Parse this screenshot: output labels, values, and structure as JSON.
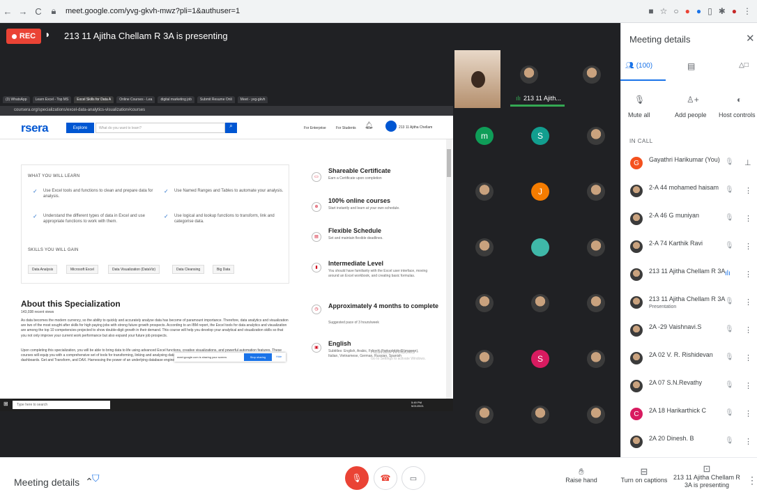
{
  "browser": {
    "url": "meet.google.com/yvg-gkvh-mwz?pli=1&authuser=1"
  },
  "meet": {
    "rec_label": "REC",
    "presenting_text": "213 11 Ajitha Chellam R 3A is presenting",
    "presenter_tile_name": "213 11 Ajith..."
  },
  "shared_screen": {
    "tabs": [
      "(3) WhatsApp",
      "Learn Excel - Top MS",
      "Excel Skills for Data A",
      "Online Courses - Lea",
      "digital marketing job",
      "Submit Resume Onli",
      "Meet - yvg-gkvh"
    ],
    "address": "coursera.org/specializations/excel-data-analytics-visualization#courses",
    "logo": "rsera",
    "explore": "Explore",
    "search_placeholder": "What do you want to learn?",
    "for_enterprise": "For Enterprise",
    "for_students": "For Students",
    "user_name": "213 11 Ajitha Chellam",
    "learn_heading": "WHAT YOU WILL LEARN",
    "learn_items": [
      "Use Excel tools and functions to clean and prepare data for analysis.",
      "Use Named Ranges and Tables to automate your analysis.",
      "Understand the different types of data in Excel and use appropriate functions to work with them.",
      "Use logical and lookup functions to transform, link and categorise data."
    ],
    "skills_heading": "SKILLS YOU WILL GAIN",
    "skills": [
      "Data Analysis",
      "Microsoft Excel",
      "Data Visualization (DataViz)",
      "Data Cleansing",
      "Big Data"
    ],
    "about_heading": "About this Specialization",
    "about_views": "143,038 recent views",
    "about_p1": "As data becomes the modern currency, so the ability to quickly and accurately analyse data has become of paramount importance. Therefore, data analytics and visualization are two of the most sought after skills for high paying jobs with strong future growth prospects. According to an IBM report, the Excel tools for data analytics and visualization are among the top 10 competencies projected to show double-digit growth in their demand. This course will help you develop your analytical and visualization skills so that you not only improve your current work performance but also expand your future job prospects.",
    "about_p2": "Upon completing this specialization, you will be able to bring data to life using advanced Excel functions, creative visualizations, and powerful automation features. These courses will equip you with a comprehensive set of tools for transforming, linking and analysing data. You will master a broad range of charts and create stunning interactive dashboards. Get and Transform, and DAX. Harnessing the power of an underlying database engine we will remove the 1 million row limitation, completely",
    "features": [
      {
        "icon": "▭",
        "title": "Shareable Certificate",
        "sub": "Earn a Certificate upon completion"
      },
      {
        "icon": "⊕",
        "title": "100% online courses",
        "sub": "Start instantly and learn at your own schedule."
      },
      {
        "icon": "▤",
        "title": "Flexible Schedule",
        "sub": "Set and maintain flexible deadlines."
      },
      {
        "icon": "▮",
        "title": "Intermediate Level",
        "sub": "You should have familiarity with the Excel user interface, moving around an Excel workbook, and creating basic formulas."
      },
      {
        "icon": "◷",
        "title": "Approximately 4 months to complete",
        "sub": "Suggested pace of 3 hours/week"
      },
      {
        "icon": "▣",
        "title": "English",
        "sub": "Subtitles: English, Arabic, French, Portuguese (European), Italian, Vietnamese, German, Russian, Spanish"
      }
    ],
    "activate_title": "Activate Windows",
    "activate_sub": "Go to Settings to activate Windows.",
    "sharing_text": "meet.google.com is sharing your screen.",
    "stop_sharing": "Stop sharing",
    "hide": "Hide",
    "taskbar_search": "Type here to search",
    "clock_time": "5:49 PM",
    "clock_date": "5/21/2021"
  },
  "grid_tiles": [
    {
      "kind": "letter",
      "letter": "m",
      "color": "#0f9d58"
    },
    {
      "kind": "letter",
      "letter": "S",
      "color": "#129e8f"
    },
    {
      "kind": "photo"
    },
    {
      "kind": "photo"
    },
    {
      "kind": "letter",
      "letter": "J",
      "color": "#f57c00"
    },
    {
      "kind": "photo"
    },
    {
      "kind": "photo"
    },
    {
      "kind": "letter",
      "letter": "",
      "color": "#3fb8a8"
    },
    {
      "kind": "photo"
    },
    {
      "kind": "photo"
    },
    {
      "kind": "photo"
    },
    {
      "kind": "photo"
    },
    {
      "kind": "photo"
    },
    {
      "kind": "letter",
      "letter": "S",
      "color": "#d81b60"
    },
    {
      "kind": "photo"
    },
    {
      "kind": "photo"
    },
    {
      "kind": "photo"
    },
    {
      "kind": "photo"
    }
  ],
  "sidebar": {
    "title": "Meeting details",
    "people_count": "(100)",
    "mute_all": "Mute all",
    "add_people": "Add people",
    "host_controls": "Host controls",
    "in_call": "IN CALL",
    "participants": [
      {
        "name": "Gayathri Harikumar (You)",
        "sub": "",
        "avatar": "letter",
        "letter": "G",
        "color": "#f4511e",
        "mic": "off",
        "pin": true
      },
      {
        "name": "2-A 44 mohamed haisam",
        "sub": "",
        "avatar": "photo",
        "mic": "off"
      },
      {
        "name": "2-A 46 G muniyan",
        "sub": "",
        "avatar": "photo",
        "mic": "off"
      },
      {
        "name": "2-A 74 Karthik Ravi",
        "sub": "",
        "avatar": "photo",
        "mic": "off"
      },
      {
        "name": "213 11 Ajitha Chellam R 3A",
        "sub": "",
        "avatar": "photo",
        "mic": "on"
      },
      {
        "name": "213 11 Ajitha Chellam R 3A",
        "sub": "Presentation",
        "avatar": "photo",
        "mic": "off"
      },
      {
        "name": "2A -29 Vaishnavi.S",
        "sub": "",
        "avatar": "photo",
        "mic": "off"
      },
      {
        "name": "2A 02 V. R. Rishidevan",
        "sub": "",
        "avatar": "photo",
        "mic": "off"
      },
      {
        "name": "2A 07 S.N.Revathy",
        "sub": "",
        "avatar": "photo",
        "mic": "off"
      },
      {
        "name": "2A 18 Harikarthick C",
        "sub": "",
        "avatar": "letter",
        "letter": "C",
        "color": "#d81b60",
        "mic": "off"
      },
      {
        "name": "2A 20 Dinesh. B",
        "sub": "",
        "avatar": "photo",
        "mic": "off"
      }
    ]
  },
  "bottom": {
    "meeting_details": "Meeting details",
    "raise_hand": "Raise hand",
    "captions": "Turn on captions",
    "presenting": "213 11 Ajitha Chellam R 3A is presenting"
  }
}
